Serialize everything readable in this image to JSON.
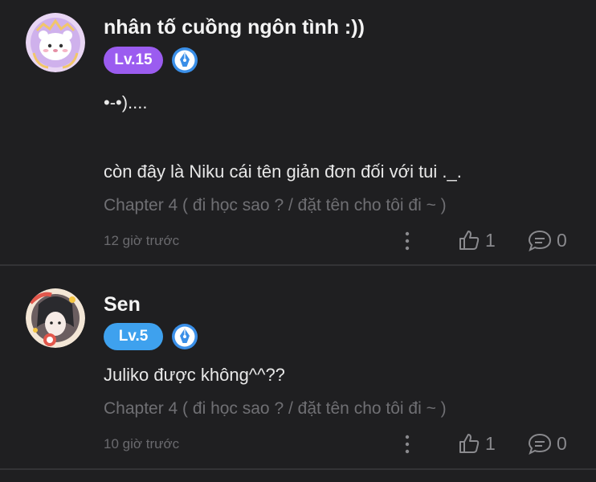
{
  "comments": [
    {
      "username": "nhân tố cuồng ngôn tình :))",
      "level": "Lv.15",
      "lines": [
        "•-•)....",
        "",
        "còn đây là Niku cái tên giản đơn đối với tui ._."
      ],
      "chapter": "Chapter 4 ( đi học sao ? / đặt tên cho tôi đi ~ )",
      "time": "12 giờ trước",
      "likes": "1",
      "replies": "0"
    },
    {
      "username": "Sen",
      "level": "Lv.5",
      "lines": [
        "Juliko được không^^??"
      ],
      "chapter": "Chapter 4 ( đi học sao ? / đặt tên cho tôi đi ~ )",
      "time": "10 giờ trước",
      "likes": "1",
      "replies": "0"
    }
  ],
  "icons": {
    "author_badge": "fountain-pen-icon",
    "more": "vertical-dots-icon",
    "like": "thumbs-up-icon",
    "reply": "speech-bubble-icon"
  },
  "colors": {
    "background": "#1f1f21",
    "level15_badge": "#9b5cf0",
    "level5_badge": "#3ea1ee",
    "author_badge": "#3a8fe8"
  }
}
